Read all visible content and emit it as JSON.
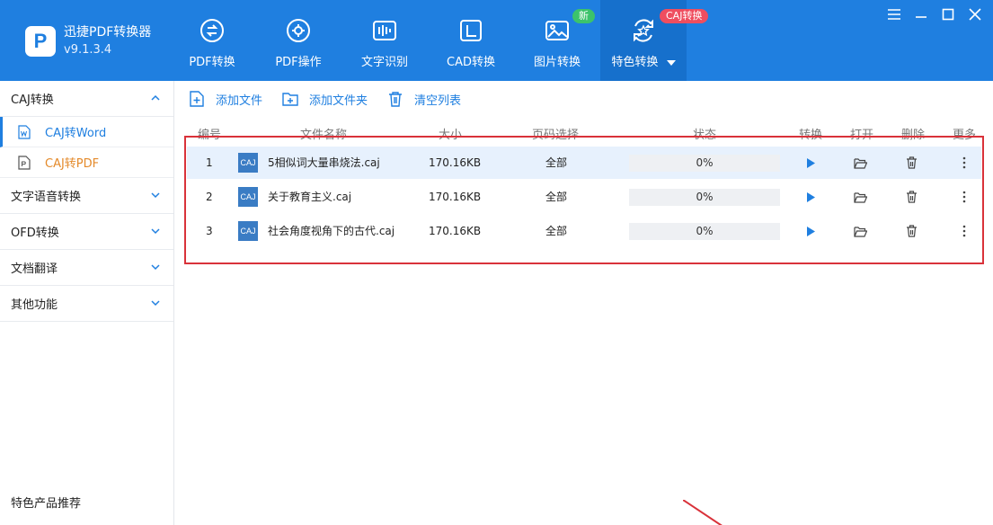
{
  "app": {
    "name": "迅捷PDF转换器",
    "version": "v9.1.3.4",
    "logo_letter": "P"
  },
  "nav": {
    "items": [
      {
        "label": "PDF转换",
        "icon": "pdf-convert-icon"
      },
      {
        "label": "PDF操作",
        "icon": "pdf-operate-icon"
      },
      {
        "label": "文字识别",
        "icon": "ocr-icon"
      },
      {
        "label": "CAD转换",
        "icon": "cad-icon"
      },
      {
        "label": "图片转换",
        "icon": "image-icon",
        "badge": "新"
      },
      {
        "label": "特色转换",
        "icon": "special-convert-icon",
        "badge": "CAJ转换",
        "active": true
      }
    ]
  },
  "window_controls": {
    "menu": "menu-icon",
    "minimize": "minimize-icon",
    "maximize": "maximize-icon",
    "close": "close-icon"
  },
  "sidebar": {
    "groups": [
      {
        "label": "CAJ转换",
        "expanded": true,
        "children": [
          {
            "label": "CAJ转Word",
            "active": true
          },
          {
            "label": "CAJ转PDF"
          }
        ]
      },
      {
        "label": "文字语音转换"
      },
      {
        "label": "OFD转换"
      },
      {
        "label": "文档翻译"
      },
      {
        "label": "其他功能"
      }
    ],
    "promo": "特色产品推荐"
  },
  "toolbar": {
    "add_file": "添加文件",
    "add_folder": "添加文件夹",
    "clear_list": "清空列表"
  },
  "table": {
    "columns": [
      "编号",
      "文件名称",
      "大小",
      "页码选择",
      "状态",
      "转换",
      "打开",
      "删除",
      "更多"
    ],
    "rows": [
      {
        "index": "1",
        "type": "CAJ",
        "name": "5相似词大量串烧法.caj",
        "size": "170.16KB",
        "pages": "全部",
        "progress": 0,
        "status": "0%",
        "selected": true
      },
      {
        "index": "2",
        "type": "CAJ",
        "name": "关于教育主义.caj",
        "size": "170.16KB",
        "pages": "全部",
        "progress": 0,
        "status": "0%"
      },
      {
        "index": "3",
        "type": "CAJ",
        "name": "社会角度视角下的古代.caj",
        "size": "170.16KB",
        "pages": "全部",
        "progress": 0,
        "status": "0%"
      }
    ]
  },
  "colors": {
    "brand": "#1f7fe0",
    "highlight_box": "#d9323a",
    "badge_new": "#3cc36b",
    "badge_caj": "#ef4e5f",
    "caj_pdf_label": "#e48a2b"
  }
}
